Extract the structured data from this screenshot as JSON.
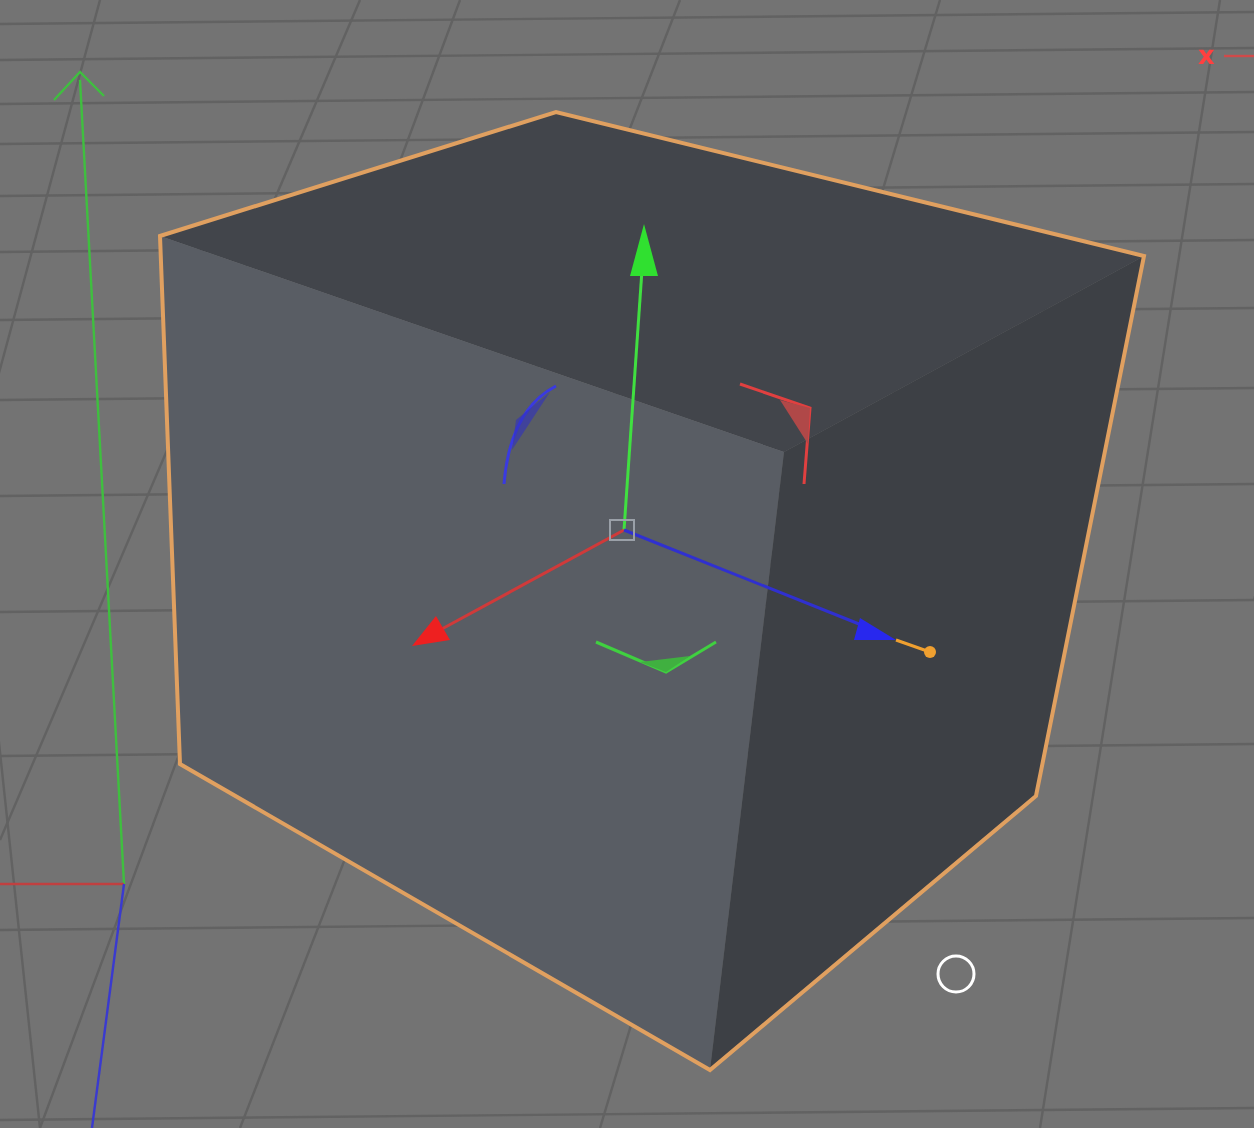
{
  "viewport": {
    "axis_label": "x"
  }
}
